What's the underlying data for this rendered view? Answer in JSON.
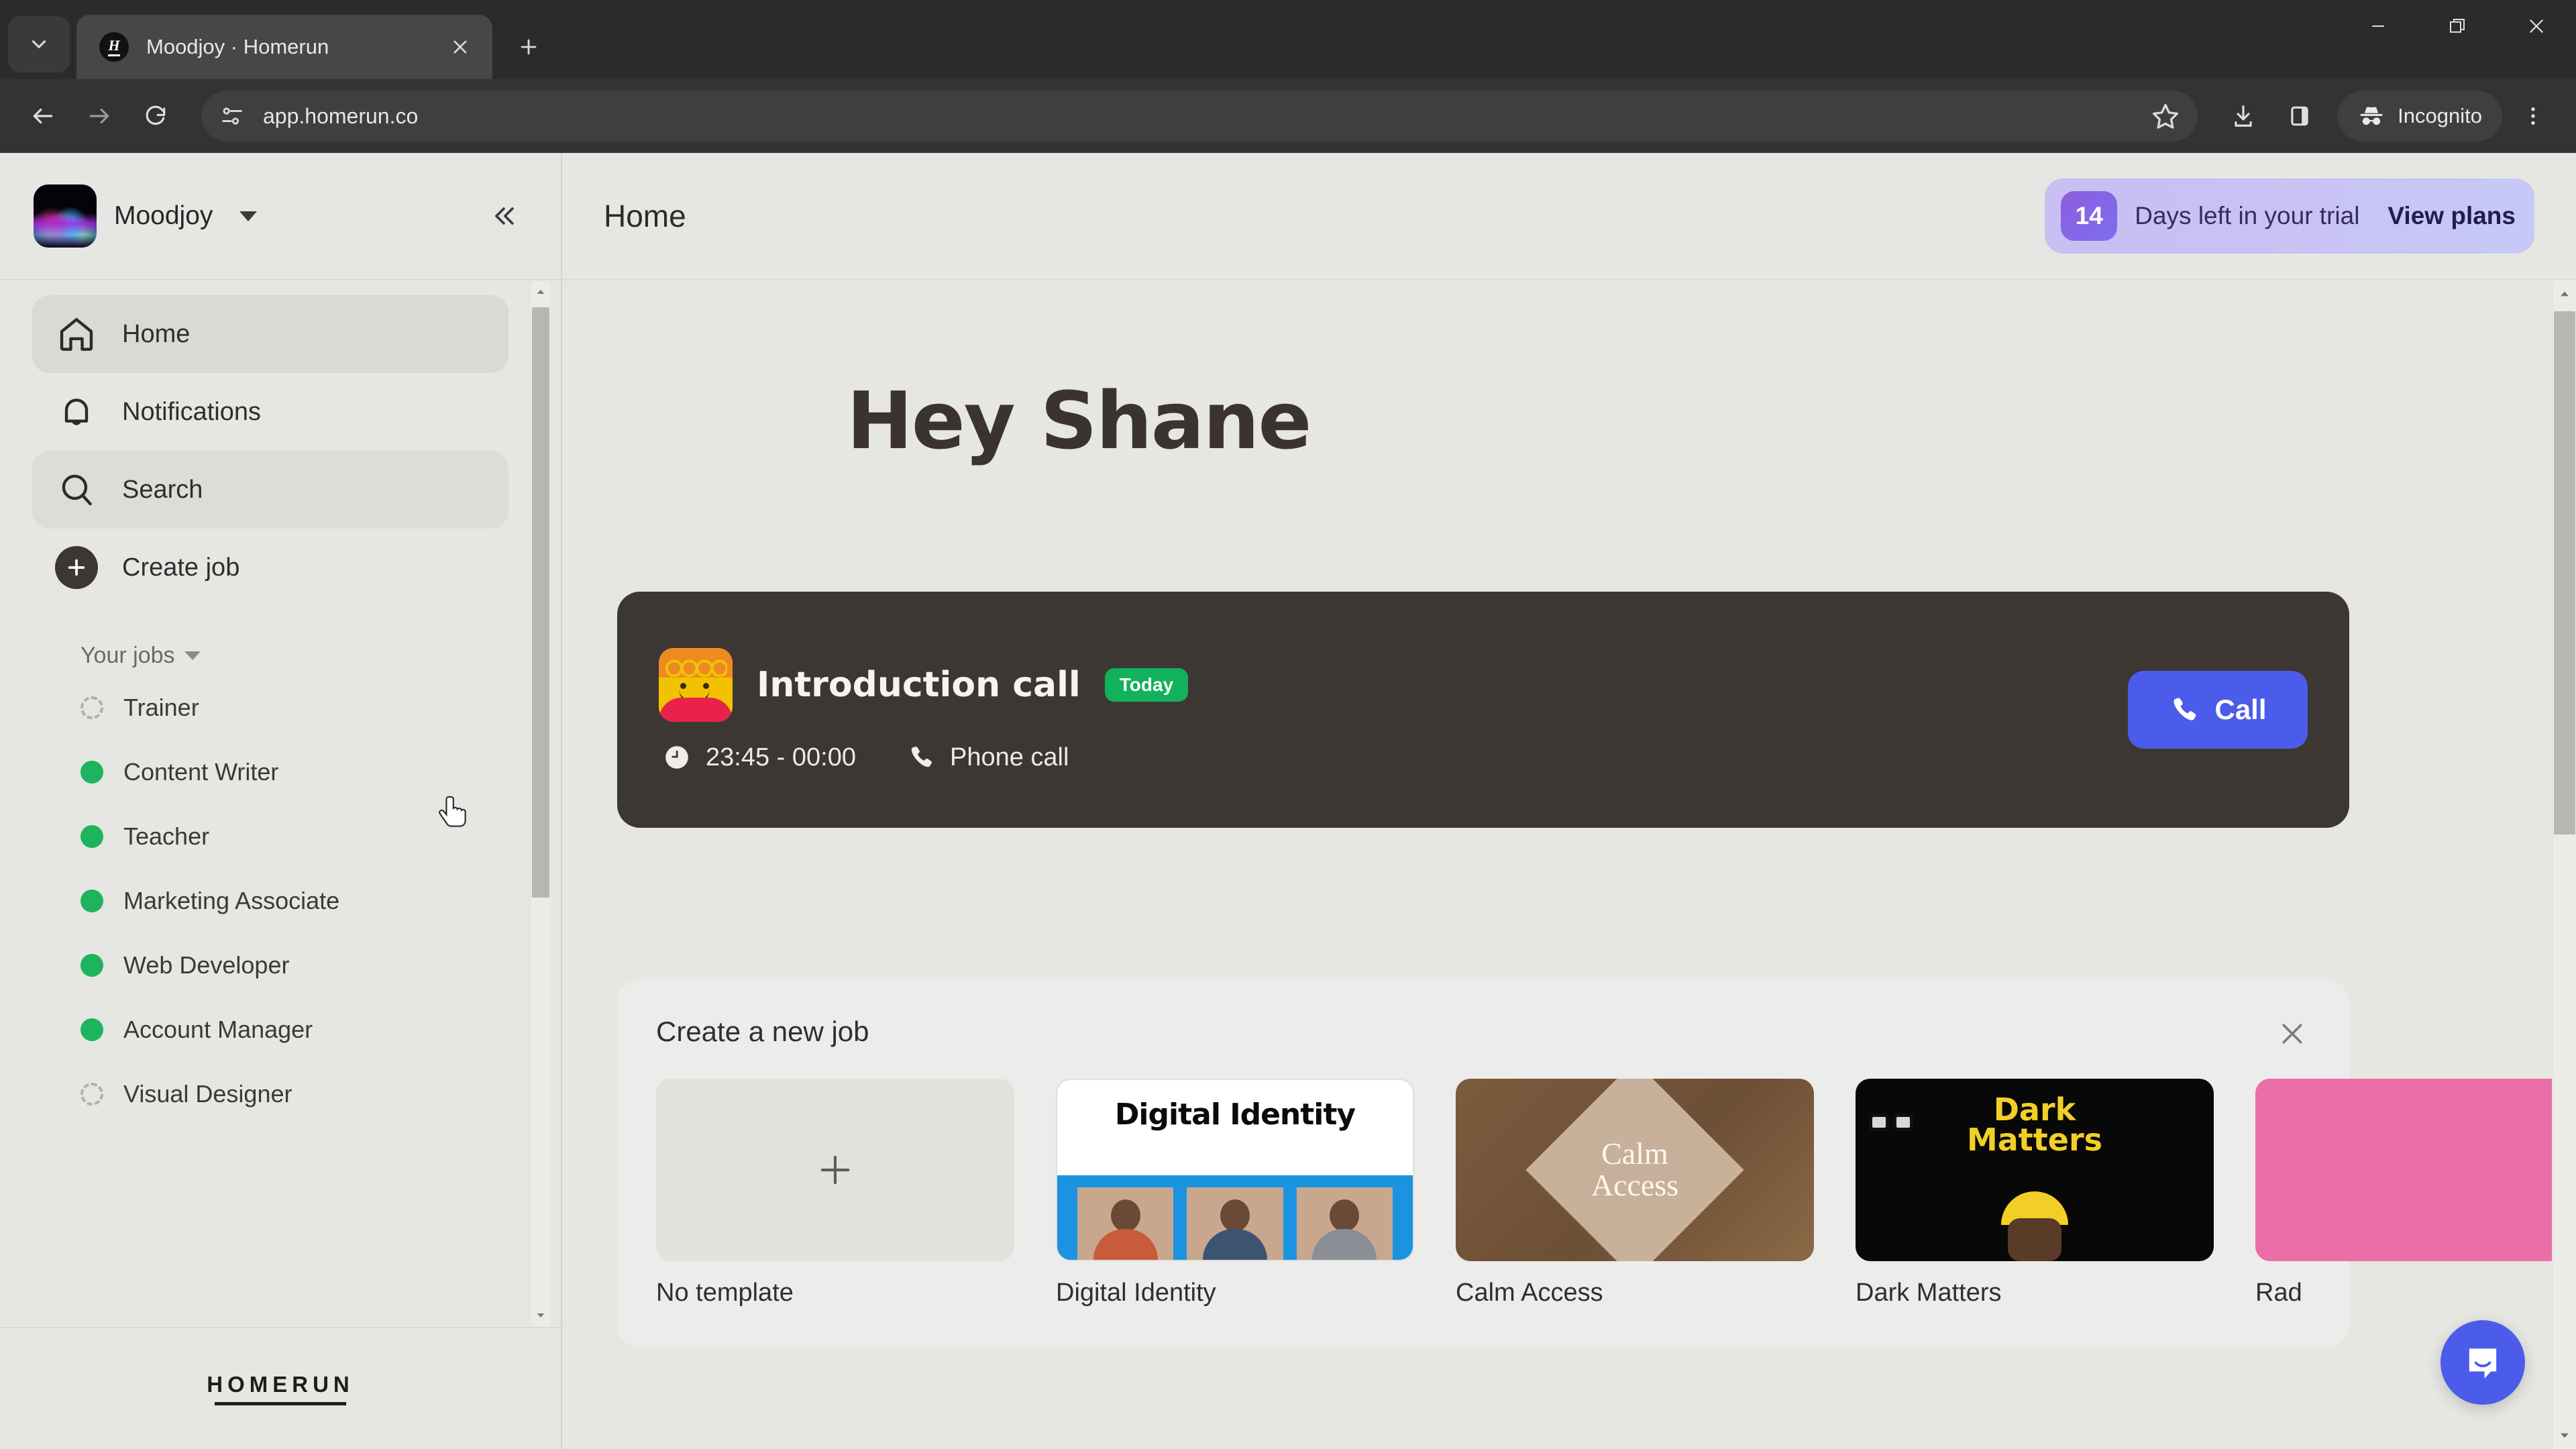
{
  "browser": {
    "tab": {
      "title": "Moodjoy · Homerun",
      "favicon_letter": "H"
    },
    "tab_list_icon": "chevron-down-icon",
    "new_tab_label": "+",
    "url": "app.homerun.co",
    "profile_label": "Incognito",
    "window_controls": {
      "minimize": "—",
      "maximize": "▢",
      "close": "✕"
    }
  },
  "sidebar": {
    "org_name": "Moodjoy",
    "collapse_label": "«",
    "nav": [
      {
        "label": "Home",
        "icon": "home-icon",
        "state": "active"
      },
      {
        "label": "Notifications",
        "icon": "bell-icon",
        "state": "default"
      },
      {
        "label": "Search",
        "icon": "search-icon",
        "state": "hover"
      },
      {
        "label": "Create job",
        "icon": "plus-circle-icon",
        "state": "default"
      }
    ],
    "jobs_section_label": "Your jobs",
    "jobs": [
      {
        "name": "Trainer",
        "status": "draft"
      },
      {
        "name": "Content Writer",
        "status": "live"
      },
      {
        "name": "Teacher",
        "status": "live"
      },
      {
        "name": "Marketing Associate",
        "status": "live"
      },
      {
        "name": "Web Developer",
        "status": "live"
      },
      {
        "name": "Account Manager",
        "status": "live"
      },
      {
        "name": "Visual Designer",
        "status": "draft"
      }
    ],
    "footer_logo": "HOMERUN"
  },
  "main": {
    "page_title": "Home",
    "trial": {
      "days": "14",
      "text": "Days left in your trial",
      "cta": "View plans"
    },
    "greeting": "Hey Shane",
    "call_card": {
      "title": "Introduction call",
      "badge": "Today",
      "time": "23:45 - 00:00",
      "type": "Phone call",
      "button_label": "Call"
    },
    "new_job": {
      "heading": "Create a new job",
      "close_label": "✕",
      "templates": [
        {
          "name": "No template",
          "kind": "none"
        },
        {
          "name": "Digital Identity",
          "kind": "digital",
          "thumb_text": "Digital Identity"
        },
        {
          "name": "Calm Access",
          "kind": "calm",
          "thumb_text_line1": "Calm",
          "thumb_text_line2": "Access"
        },
        {
          "name": "Dark Matters",
          "kind": "dark",
          "thumb_text_line1": "Dark",
          "thumb_text_line2": "Matters"
        },
        {
          "name": "Rad",
          "kind": "radio"
        }
      ]
    },
    "intercom_icon": "chat-bubble-icon"
  },
  "colors": {
    "accent_blue": "#4b5ceb",
    "status_green": "#1eb45f",
    "badge_green": "#12b15c",
    "trial_purple": "#c8bff2",
    "card_dark": "#3d3733",
    "page_bg": "#e6e6e3"
  }
}
